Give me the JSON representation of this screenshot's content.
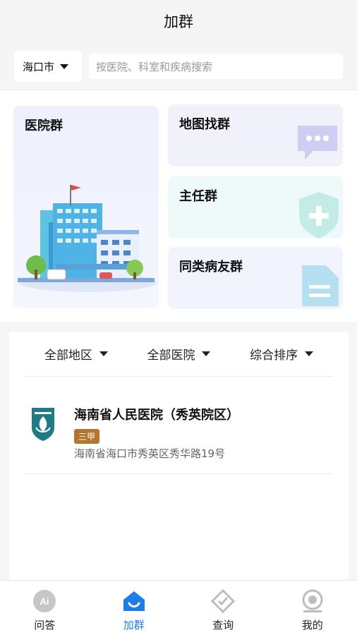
{
  "header": {
    "title": "加群"
  },
  "search": {
    "city": "海口市",
    "placeholder": "按医院、科室和疾病搜索"
  },
  "cards": {
    "hospital_group": "医院群",
    "map_group": "地图找群",
    "director_group": "主任群",
    "patient_group": "同类病友群"
  },
  "filters": [
    "全部地区",
    "全部医院",
    "综合排序"
  ],
  "hospitals": [
    {
      "name": "海南省人民医院（秀英院区）",
      "level": "三甲",
      "address": "海南省海口市秀英区秀华路19号"
    }
  ],
  "tabbar": {
    "items": [
      {
        "label": "问答",
        "icon": "ai-icon"
      },
      {
        "label": "加群",
        "icon": "home-smile-icon"
      },
      {
        "label": "查询",
        "icon": "diamond-check-icon"
      },
      {
        "label": "我的",
        "icon": "profile-icon"
      }
    ],
    "active_index": 1,
    "ai_badge": "Ai"
  },
  "colors": {
    "accent": "#1f7de6",
    "badge": "#b5762b"
  }
}
